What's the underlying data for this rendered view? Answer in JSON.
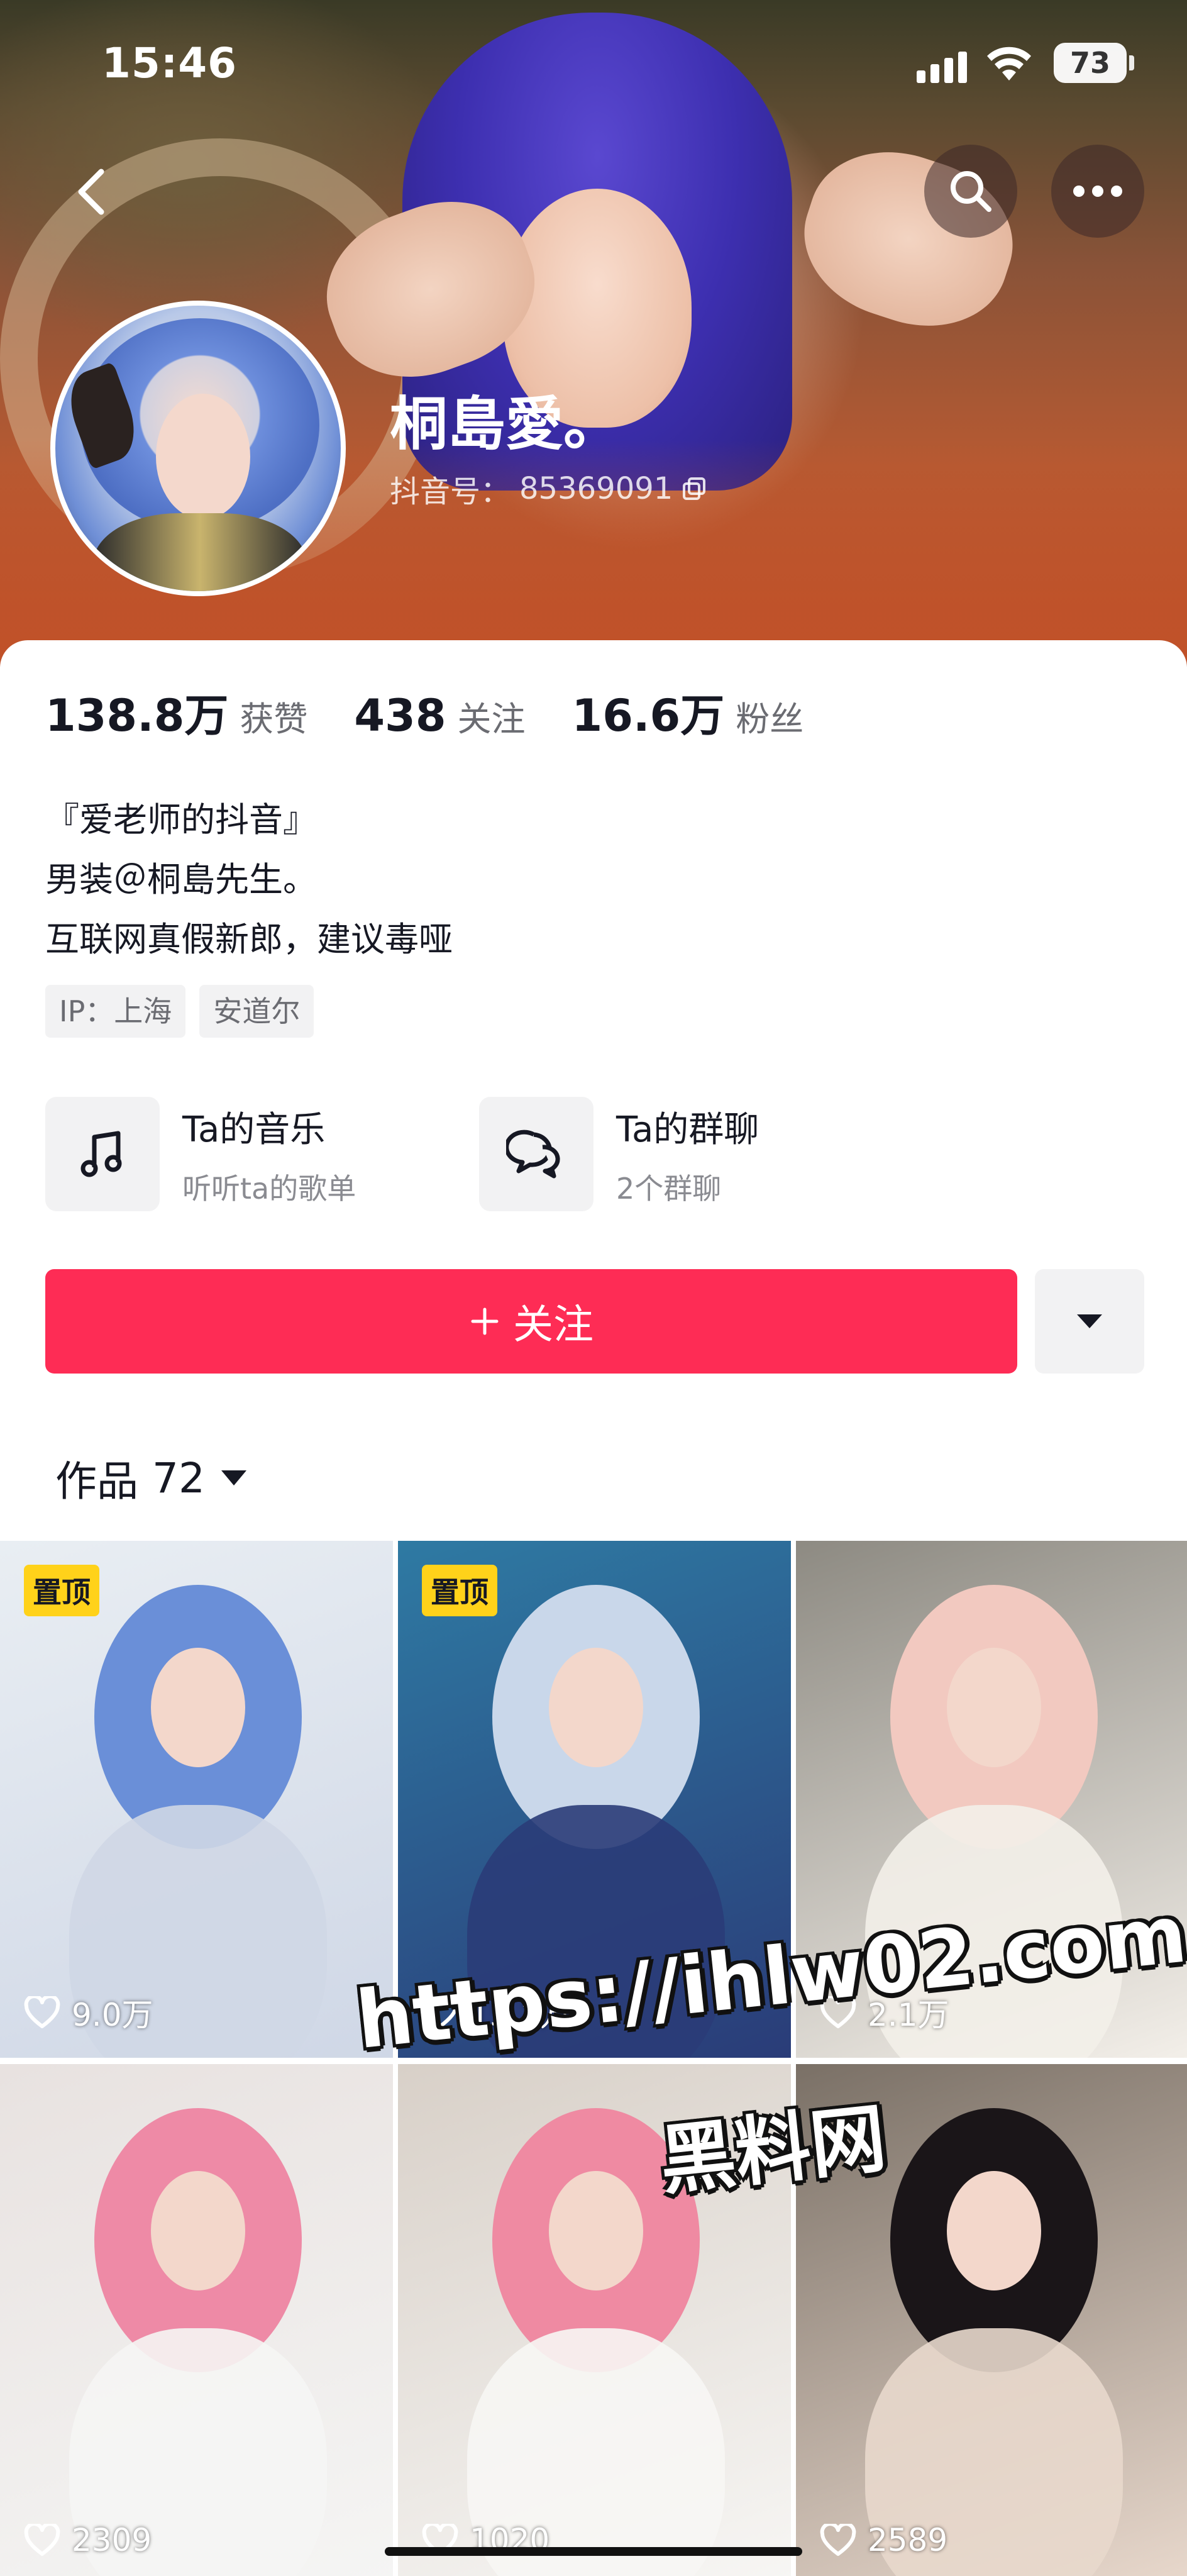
{
  "status_bar": {
    "time": "15:46",
    "battery": "73"
  },
  "profile": {
    "name": "桐島愛。",
    "douyin_id_label": "抖音号：",
    "douyin_id": "85369091"
  },
  "stats": [
    {
      "value": "138.8万",
      "label": "获赞"
    },
    {
      "value": "438",
      "label": "关注"
    },
    {
      "value": "16.6万",
      "label": "粉丝"
    }
  ],
  "bio": [
    "『爱老师的抖音』",
    "男装＠桐島先生。",
    "互联网真假新郎，建议毒哑"
  ],
  "tags": [
    "IP：上海",
    "安道尔"
  ],
  "features": [
    {
      "title": "Ta的音乐",
      "subtitle": "听听ta的歌单",
      "icon": "music-note-icon"
    },
    {
      "title": "Ta的群聊",
      "subtitle": "2个群聊",
      "icon": "chat-bubbles-icon"
    }
  ],
  "follow_button": {
    "label": "关注",
    "icon": "plus-icon"
  },
  "works_tab": {
    "label": "作品",
    "count": "72"
  },
  "videos": [
    {
      "pinned": true,
      "pin_label": "置顶",
      "likes": "9.0万",
      "colors": [
        "#e9eef3",
        "#6a8fd8",
        "#cfd7e6"
      ]
    },
    {
      "pinned": true,
      "pin_label": "置顶",
      "likes": "15.1万",
      "colors": [
        "#2e7aa3",
        "#c9d7ea",
        "#2a3c78"
      ]
    },
    {
      "pinned": false,
      "pin_label": "",
      "likes": "2.1万",
      "colors": [
        "#8d8a82",
        "#f2c9c0",
        "#f3efe9"
      ]
    },
    {
      "pinned": false,
      "pin_label": "",
      "likes": "2309",
      "colors": [
        "#e8e2e0",
        "#ee8aa6",
        "#f5f5f4"
      ]
    },
    {
      "pinned": false,
      "pin_label": "",
      "likes": "1020",
      "colors": [
        "#d8d0c8",
        "#ef8aa2",
        "#f7f6f4"
      ]
    },
    {
      "pinned": false,
      "pin_label": "",
      "likes": "2589",
      "colors": [
        "#7a7066",
        "#1a1518",
        "#e8d8cc"
      ]
    }
  ],
  "watermark": {
    "url": "https://ihlw02.com",
    "name": "黑料网"
  },
  "colors": {
    "follow": "#fe2c55",
    "pin_badge": "#ffd21a",
    "text": "#161823",
    "muted": "#6b6c72"
  }
}
